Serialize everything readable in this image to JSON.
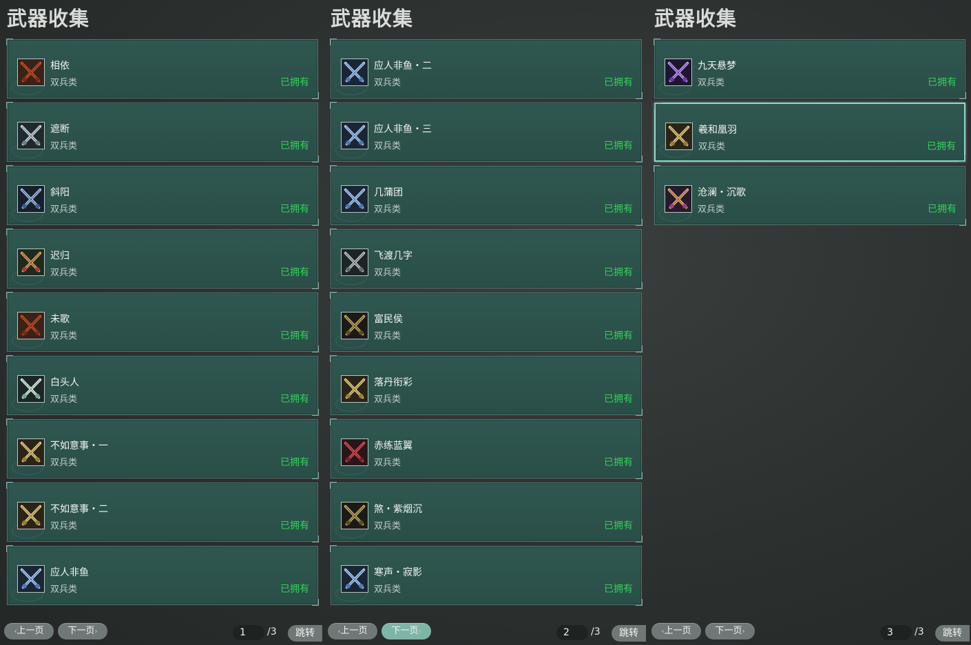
{
  "panels": [
    {
      "title": "武器收集",
      "items": [
        {
          "name": "相依",
          "type": "双兵类",
          "status": "已拥有",
          "icon": "twin-axes-red-icon"
        },
        {
          "name": "遮断",
          "type": "双兵类",
          "status": "已拥有",
          "icon": "twin-chakram-silver-icon"
        },
        {
          "name": "斜阳",
          "type": "双兵类",
          "status": "已拥有",
          "icon": "twin-blade-blue-icon"
        },
        {
          "name": "迟归",
          "type": "双兵类",
          "status": "已拥有",
          "icon": "twin-swords-green-red-icon"
        },
        {
          "name": "未歌",
          "type": "双兵类",
          "status": "已拥有",
          "icon": "twin-axes-red-icon"
        },
        {
          "name": "白头人",
          "type": "双兵类",
          "status": "已拥有",
          "icon": "twin-swords-white-icon"
        },
        {
          "name": "不如意事・一",
          "type": "双兵类",
          "status": "已拥有",
          "icon": "twin-swords-gold-icon"
        },
        {
          "name": "不如意事・二",
          "type": "双兵类",
          "status": "已拥有",
          "icon": "twin-swords-gold-icon"
        },
        {
          "name": "应人非鱼",
          "type": "双兵类",
          "status": "已拥有",
          "icon": "twin-swords-blue-icon"
        }
      ],
      "pager": {
        "prev": "上一页",
        "next": "下一页",
        "current": "1",
        "total": "/3",
        "jump": "跳转",
        "active": "next"
      }
    },
    {
      "title": "武器收集",
      "items": [
        {
          "name": "应人非鱼・二",
          "type": "双兵类",
          "status": "已拥有",
          "icon": "twin-swords-blue-icon"
        },
        {
          "name": "应人非鱼・三",
          "type": "双兵类",
          "status": "已拥有",
          "icon": "twin-swords-blue-icon"
        },
        {
          "name": "几蒲团",
          "type": "双兵类",
          "status": "已拥有",
          "icon": "twin-swords-blue-icon"
        },
        {
          "name": "飞渡几字",
          "type": "双兵类",
          "status": "已拥有",
          "icon": "twin-swords-steel-icon"
        },
        {
          "name": "富民侯",
          "type": "双兵类",
          "status": "已拥有",
          "icon": "twin-swords-dark-gold-icon"
        },
        {
          "name": "落丹衔彩",
          "type": "双兵类",
          "status": "已拥有",
          "icon": "twin-swords-gold-icon"
        },
        {
          "name": "赤练蓝翼",
          "type": "双兵类",
          "status": "已拥有",
          "icon": "twin-swords-red-icon"
        },
        {
          "name": "煞・紫烟沉",
          "type": "双兵类",
          "status": "已拥有",
          "icon": "twin-swords-dark-gold-icon"
        },
        {
          "name": "寒声・寂影",
          "type": "双兵类",
          "status": "已拥有",
          "icon": "twin-swords-blue-icon"
        }
      ],
      "pager": {
        "prev": "上一页",
        "next": "下一页",
        "current": "2",
        "total": "/3",
        "jump": "跳转",
        "active": "next"
      }
    },
    {
      "title": "武器收集",
      "items": [
        {
          "name": "九天悬梦",
          "type": "双兵类",
          "status": "已拥有",
          "icon": "twin-swords-purple-icon"
        },
        {
          "name": "羲和凰羽",
          "type": "双兵类",
          "status": "已拥有",
          "icon": "twin-swords-gold-icon",
          "selected": true
        },
        {
          "name": "沧澜・沉歌",
          "type": "双兵类",
          "status": "已拥有",
          "icon": "twin-swords-purple-gold-icon"
        }
      ],
      "pager": {
        "prev": "上一页",
        "next": "下一页",
        "current": "3",
        "total": "/3",
        "jump": "跳转",
        "active": "none"
      }
    }
  ],
  "colors": {
    "owned": "#34d15a",
    "card_bg": "#2f5750",
    "selected_border": "#8fd9d0"
  }
}
